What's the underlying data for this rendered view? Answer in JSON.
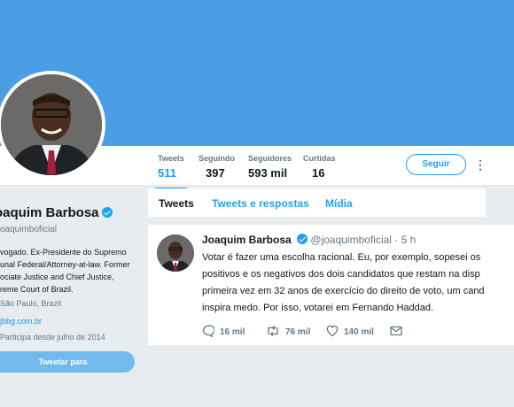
{
  "profile": {
    "name": "oaquim Barbosa",
    "handle": "oaquimboficial",
    "bio_lines": [
      "vogado. Ex-Presidente do Supremo",
      "unal Federal/Attorney-at-law. Former",
      "ociate Justice and Chief Justice,",
      "reme Court of Brazil."
    ],
    "location": "São Paulo, Brazil",
    "website": "jbbg.com.br",
    "joined": "Participa desde julho de 2014",
    "tweet_button": "Tweetar para"
  },
  "stats": [
    {
      "label": "Tweets",
      "value": "511"
    },
    {
      "label": "Seguindo",
      "value": "397"
    },
    {
      "label": "Seguidores",
      "value": "593 mil"
    },
    {
      "label": "Curtidas",
      "value": "16"
    }
  ],
  "follow_button": "Seguir",
  "tabs": [
    {
      "label": "Tweets"
    },
    {
      "label": "Tweets e respostas"
    },
    {
      "label": "Mídia"
    }
  ],
  "tweet": {
    "author": "Joaquim Barbosa",
    "handle": "@joaquimboficial",
    "time": "· 5 h",
    "lines": [
      "Votar é fazer uma escolha racional. Eu, por exemplo, sopesei os",
      "positivos e os negativos dos dois candidatos que restam na disp",
      "primeira vez em 32 anos de exercício do direito de voto, um cand",
      "inspira medo. Por isso, votarei  em Fernando Haddad."
    ],
    "replies": "16 mil",
    "retweets": "76 mil",
    "likes": "140 mil"
  },
  "colors": {
    "accent": "#1da1f2",
    "banner": "#4a9ee6"
  }
}
